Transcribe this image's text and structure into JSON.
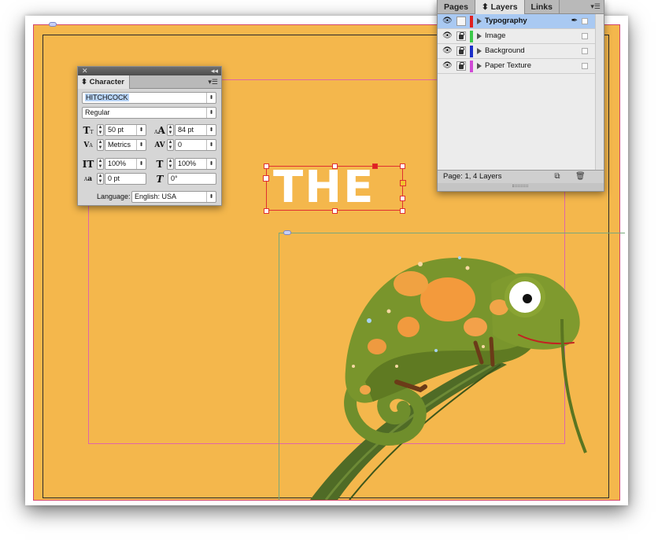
{
  "colors": {
    "paper": "#f4b74c",
    "bleed_guide": "#d3456c",
    "margin_guide": "#e066a8",
    "frame_guide": "#79a87c",
    "selection": "#e03030",
    "layer_selected_bg": "#a9c9f2"
  },
  "document": {
    "headline_text": "THE"
  },
  "character_panel": {
    "tab_label": "Character",
    "font_family": "HITCHCOCK",
    "font_style": "Regular",
    "font_size": "50 pt",
    "leading": "84 pt",
    "kerning": "Metrics",
    "tracking": "0",
    "vertical_scale": "100%",
    "horizontal_scale": "100%",
    "baseline_shift": "0 pt",
    "skew": "0°",
    "language_label": "Language:",
    "language_value": "English: USA"
  },
  "layers_panel": {
    "tabs": [
      {
        "label": "Pages",
        "active": false
      },
      {
        "label": "Layers",
        "active": true
      },
      {
        "label": "Links",
        "active": false
      }
    ],
    "layers": [
      {
        "name": "Typography",
        "color": "#e02020",
        "selected": true,
        "locked": false,
        "visible": true
      },
      {
        "name": "Image",
        "color": "#3cc94a",
        "selected": false,
        "locked": true,
        "visible": true
      },
      {
        "name": "Background",
        "color": "#1b2fc9",
        "selected": false,
        "locked": true,
        "visible": true
      },
      {
        "name": "Paper Texture",
        "color": "#d04ad6",
        "selected": false,
        "locked": true,
        "visible": true
      }
    ],
    "status": "Page: 1, 4 Layers"
  },
  "icons": {
    "eye": "eye-icon",
    "lock": "lock-icon",
    "pen": "pen-icon",
    "new_layer": "new-layer-icon",
    "trash": "trash-icon",
    "panel_menu": "panel-menu-icon"
  }
}
